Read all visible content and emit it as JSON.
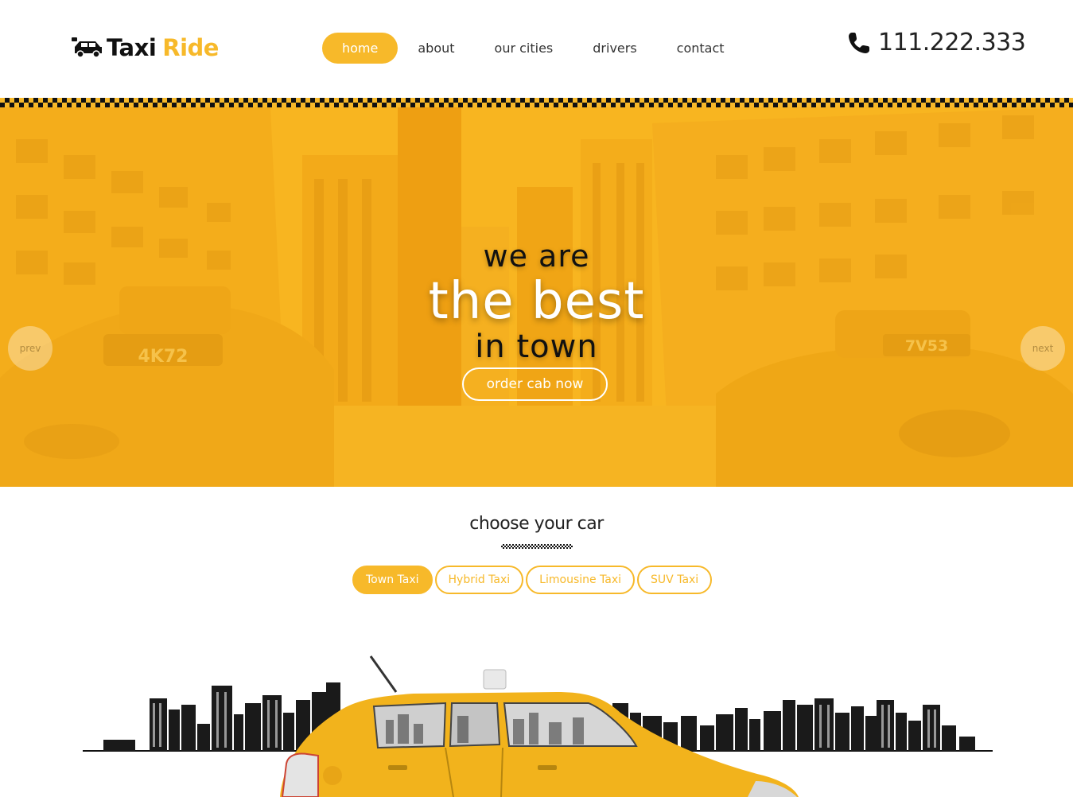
{
  "brand": {
    "name_part1": "Taxi",
    "name_part2": "Ride"
  },
  "nav": {
    "items": [
      {
        "label": "home",
        "active": true
      },
      {
        "label": "about",
        "active": false
      },
      {
        "label": "our cities",
        "active": false
      },
      {
        "label": "drivers",
        "active": false
      },
      {
        "label": "contact",
        "active": false
      }
    ]
  },
  "contact": {
    "phone": "111.222.333"
  },
  "hero": {
    "line1": "we are",
    "line2": "the best",
    "line3": "in town",
    "cta_label": "order cab now",
    "prev_label": "prev",
    "next_label": "next",
    "plate_left": "4K72",
    "plate_right": "7V53"
  },
  "choose": {
    "title": "choose your car",
    "tabs": [
      {
        "label": "Town Taxi",
        "active": true
      },
      {
        "label": "Hybrid Taxi",
        "active": false
      },
      {
        "label": "Limousine Taxi",
        "active": false
      },
      {
        "label": "SUV Taxi",
        "active": false
      }
    ]
  },
  "colors": {
    "accent": "#f7b92a",
    "text_dark": "#222222",
    "white": "#ffffff"
  }
}
